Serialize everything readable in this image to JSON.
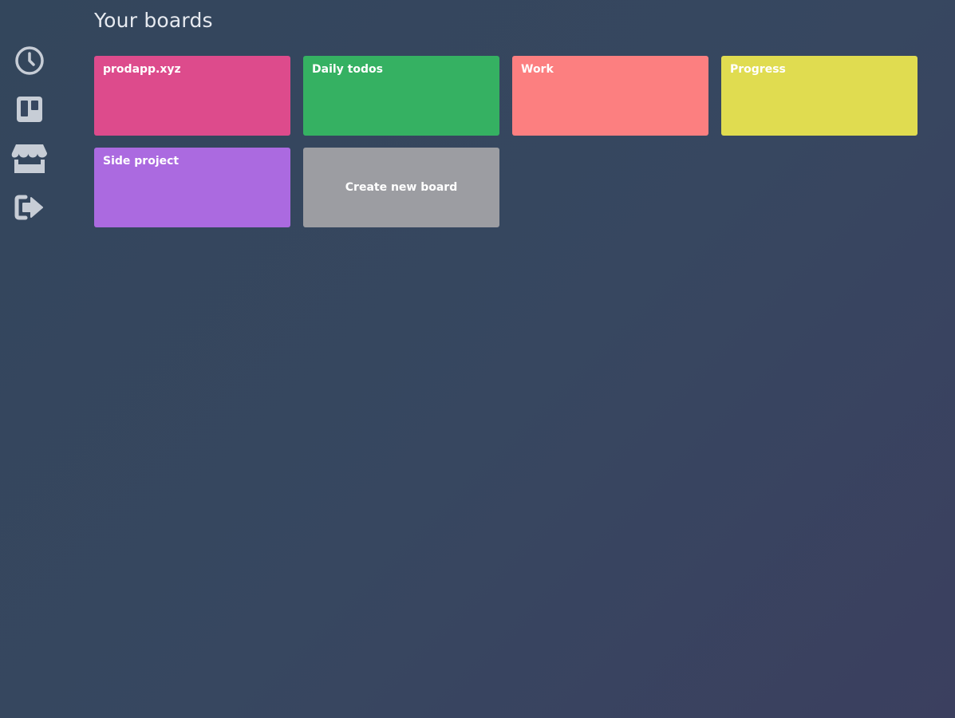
{
  "page": {
    "title": "Your boards"
  },
  "sidebar": {
    "items": [
      {
        "name": "recent",
        "icon": "clock-icon"
      },
      {
        "name": "boards",
        "icon": "board-icon"
      },
      {
        "name": "store",
        "icon": "store-icon"
      },
      {
        "name": "logout",
        "icon": "sign-out-icon"
      }
    ],
    "icon_color": "#c7cdd6"
  },
  "boards": [
    {
      "name": "prodapp.xyz",
      "color": "#dd4b8c"
    },
    {
      "name": "Daily todos",
      "color": "#35b162"
    },
    {
      "name": "Work",
      "color": "#fc7f80"
    },
    {
      "name": "Progress",
      "color": "#e0dc50"
    },
    {
      "name": "Side project",
      "color": "#ab6ae0"
    }
  ],
  "create_board": {
    "label": "Create new board",
    "color": "#9c9da2"
  }
}
